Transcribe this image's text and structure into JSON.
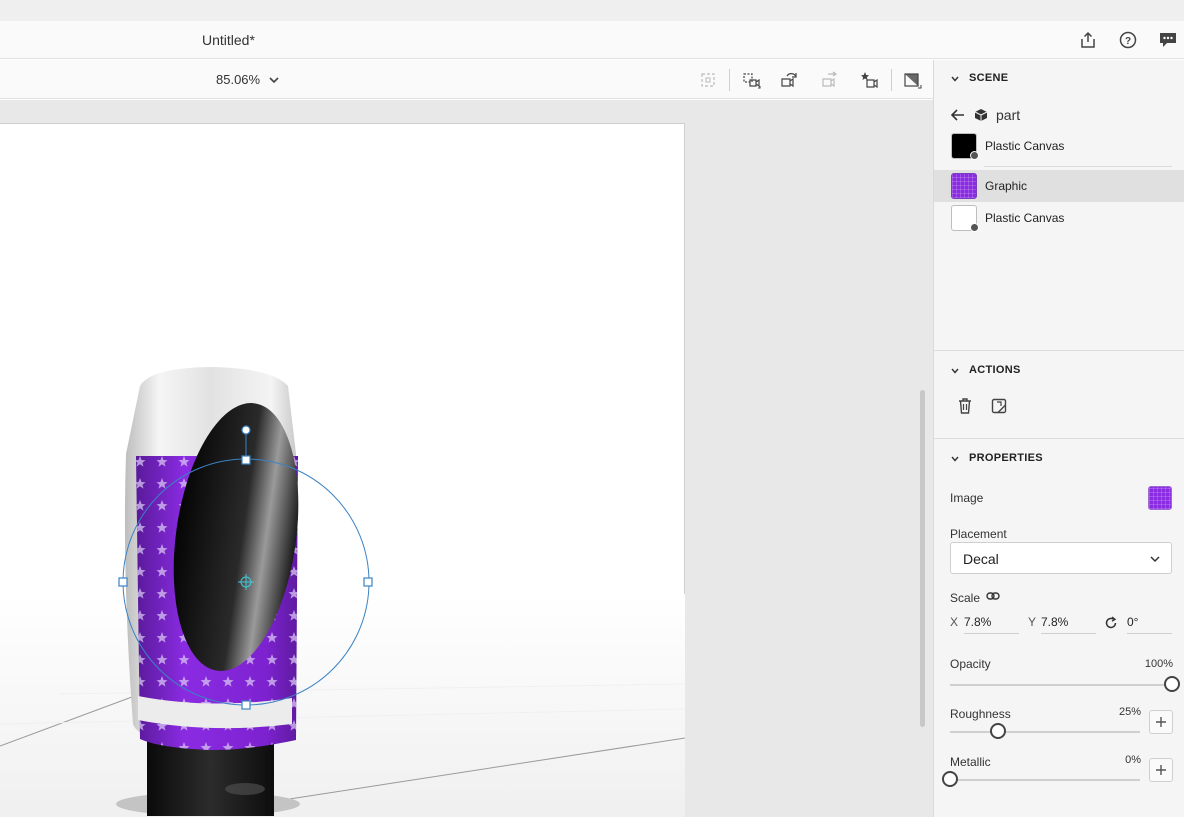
{
  "header": {
    "title": "Untitled*",
    "icons": [
      "share-icon",
      "help-icon",
      "comments-icon"
    ]
  },
  "toolbar": {
    "zoom": "85.06%",
    "icons": [
      "frame-icon",
      "camera-select-icon",
      "camera-rotate-icon",
      "camera-pan-icon",
      "camera-bookmark-icon",
      "render-preview-icon"
    ]
  },
  "panel": {
    "scene": {
      "heading": "SCENE",
      "breadcrumb": "part",
      "layers": [
        {
          "name": "Plastic Canvas",
          "thumb_color": "#000000",
          "selected": false
        },
        {
          "name": "Graphic",
          "thumb_color": "#8a2be2",
          "selected": true
        },
        {
          "name": "Plastic Canvas",
          "thumb_color": "#ffffff",
          "selected": false
        }
      ]
    },
    "actions": {
      "heading": "ACTIONS",
      "icons": [
        "delete-icon",
        "edit-decal-icon"
      ]
    },
    "properties": {
      "heading": "PROPERTIES",
      "image_label": "Image",
      "placement_label": "Placement",
      "placement_value": "Decal",
      "scale_label": "Scale",
      "x_label": "X",
      "x_value": "7.8%",
      "y_label": "Y",
      "y_value": "7.8%",
      "rotation_value": "0°",
      "opacity_label": "Opacity",
      "opacity_value": "100%",
      "opacity_level": 1.0,
      "roughness_label": "Roughness",
      "roughness_value": "25%",
      "roughness_level": 0.25,
      "metallic_label": "Metallic",
      "metallic_value": "0%",
      "metallic_level": 0.0
    }
  },
  "colors": {
    "accent": "#2680eb",
    "graphic_purple": "#8a2be2",
    "selection_blue": "#3b82c4"
  }
}
